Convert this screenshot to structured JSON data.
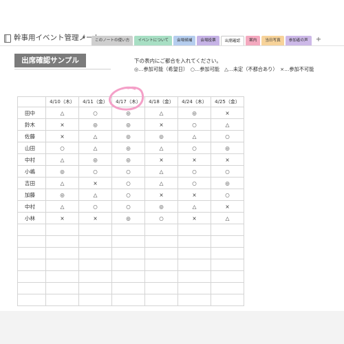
{
  "notebook": {
    "title": "幹事用イベント管理ノート",
    "chevron": "▾"
  },
  "tabs": [
    {
      "label": "このノートの使い方",
      "color": "#cfcfcf",
      "active": false
    },
    {
      "label": "イベントについて",
      "color": "#a8dfc4",
      "active": false
    },
    {
      "label": "会場候補",
      "color": "#b5cdee",
      "active": false
    },
    {
      "label": "会場投票",
      "color": "#c6b3e6",
      "active": false
    },
    {
      "label": "出席確認",
      "color": "#ffffff",
      "active": true
    },
    {
      "label": "案内",
      "color": "#f4a9bf",
      "active": false
    },
    {
      "label": "当日写真",
      "color": "#f7d39a",
      "active": false
    },
    {
      "label": "参加者の声",
      "color": "#cdb9e8",
      "active": false
    }
  ],
  "add_tab": "+",
  "section": {
    "heading": "出席確認サンプル",
    "instruction": "下の表内にご都合を入れてください。",
    "legend": "◎…参加可能（希望日）　○…参加可能　△…未定（不都合あり）　×…参加不可能"
  },
  "table": {
    "dates": [
      "4/10（木）",
      "4/11（金）",
      "4/17（木）",
      "4/18（金）",
      "4/24（木）",
      "4/25（金）"
    ],
    "rows": [
      {
        "name": "田中",
        "values": [
          "△",
          "○",
          "◎",
          "△",
          "◎",
          "×"
        ]
      },
      {
        "name": "鈴木",
        "values": [
          "×",
          "◎",
          "◎",
          "×",
          "○",
          "△"
        ]
      },
      {
        "name": "佐藤",
        "values": [
          "×",
          "△",
          "◎",
          "◎",
          "△",
          "○"
        ]
      },
      {
        "name": "山田",
        "values": [
          "○",
          "△",
          "◎",
          "△",
          "○",
          "◎"
        ]
      },
      {
        "name": "中村",
        "values": [
          "△",
          "◎",
          "◎",
          "×",
          "×",
          "×"
        ]
      },
      {
        "name": "小嶋",
        "values": [
          "◎",
          "○",
          "○",
          "△",
          "○",
          "○"
        ]
      },
      {
        "name": "吉田",
        "values": [
          "△",
          "×",
          "○",
          "△",
          "○",
          "◎"
        ]
      },
      {
        "name": "加藤",
        "values": [
          "◎",
          "△",
          "○",
          "×",
          "×",
          "○"
        ]
      },
      {
        "name": "中村",
        "values": [
          "△",
          "○",
          "○",
          "◎",
          "△",
          "×"
        ]
      },
      {
        "name": "小林",
        "values": [
          "×",
          "×",
          "◎",
          "○",
          "×",
          "△"
        ]
      }
    ],
    "empty_rows": 7
  },
  "highlight_color": "#f4a0c8"
}
